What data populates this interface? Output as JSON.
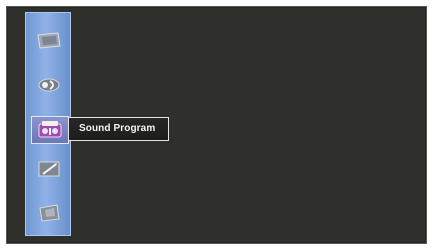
{
  "screen": {
    "background_color": "#2f2f2c"
  },
  "menu": {
    "accent_color": "#7ca3df",
    "items": [
      {
        "icon": "picture-panel-icon",
        "selected": false
      },
      {
        "icon": "sound-effect-icon",
        "selected": false
      },
      {
        "icon": "sound-program-icon",
        "selected": true,
        "label": "Sound Program"
      },
      {
        "icon": "setup-tool-icon",
        "selected": false
      },
      {
        "icon": "settings-card-icon",
        "selected": false
      }
    ]
  }
}
